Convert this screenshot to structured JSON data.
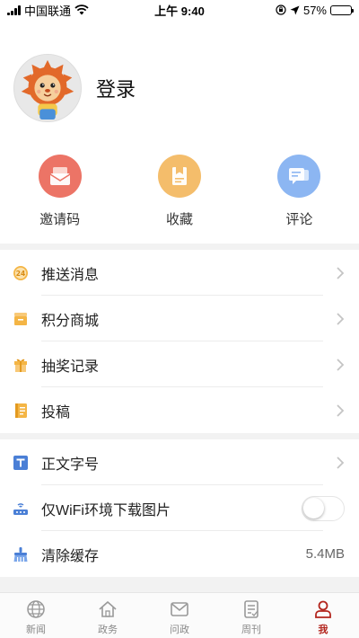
{
  "status_bar": {
    "carrier": "中国联通",
    "time": "上午 9:40",
    "battery": "57%",
    "battery_level": 0.57
  },
  "profile": {
    "login_label": "登录"
  },
  "quick_actions": [
    {
      "label": "邀请码",
      "icon": "envelope-icon",
      "color": "#ec7466"
    },
    {
      "label": "收藏",
      "icon": "bookmark-icon",
      "color": "#f4bd6b"
    },
    {
      "label": "评论",
      "icon": "comment-icon",
      "color": "#8cb6f2"
    }
  ],
  "menu_group_1": [
    {
      "label": "推送消息",
      "icon": "push-24-icon"
    },
    {
      "label": "积分商城",
      "icon": "points-mall-icon"
    },
    {
      "label": "抽奖记录",
      "icon": "gift-icon"
    },
    {
      "label": "投稿",
      "icon": "notebook-icon"
    }
  ],
  "menu_group_2": [
    {
      "label": "正文字号",
      "icon": "font-size-icon"
    },
    {
      "label": "仅WiFi环境下载图片",
      "icon": "router-icon",
      "toggle": false
    },
    {
      "label": "清除缓存",
      "icon": "broom-icon",
      "value": "5.4MB"
    }
  ],
  "tabbar": [
    {
      "label": "新闻",
      "icon": "globe-icon",
      "active": false
    },
    {
      "label": "政务",
      "icon": "home-icon",
      "active": false
    },
    {
      "label": "问政",
      "icon": "mail-icon",
      "active": false
    },
    {
      "label": "周刊",
      "icon": "document-icon",
      "active": false
    },
    {
      "label": "我",
      "icon": "person-icon",
      "active": true
    }
  ],
  "colors": {
    "accent": "#b3261e",
    "chevron": "#c4c4c4"
  }
}
